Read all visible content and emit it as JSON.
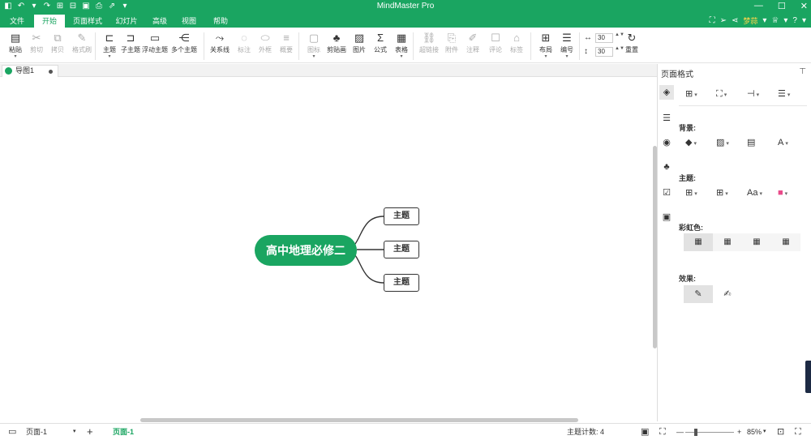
{
  "window": {
    "title": "MindMaster Pro",
    "quick_access": [
      "◧",
      "↶",
      "▾",
      "↷",
      "⊞",
      "⊟",
      "▣",
      "⎙",
      "⇗",
      "▾"
    ],
    "controls": [
      "—",
      "☐",
      "✕"
    ]
  },
  "menu": {
    "tabs": [
      "文件",
      "开始",
      "页面样式",
      "幻灯片",
      "高级",
      "视图",
      "帮助"
    ],
    "active": "开始",
    "right_icons": [
      "⛶",
      "➢",
      "⋖"
    ],
    "user": "梦蒜",
    "user_caret": "▾",
    "right_icons2": [
      "♕",
      "▾",
      "?",
      "▾"
    ]
  },
  "ribbon": {
    "buttons": [
      {
        "name": "paste",
        "label": "粘贴",
        "icon": "▤",
        "caret": "▾",
        "disabled": false
      },
      {
        "name": "cut",
        "label": "剪切",
        "icon": "✂",
        "disabled": true
      },
      {
        "name": "copy",
        "label": "拷贝",
        "icon": "⧉",
        "disabled": true
      },
      {
        "name": "format-painter",
        "label": "格式刷",
        "icon": "✎",
        "disabled": true
      },
      {
        "name": "topic",
        "label": "主题",
        "icon": "⊏",
        "caret": "▾",
        "disabled": false
      },
      {
        "name": "subtopic",
        "label": "子主题",
        "icon": "⊐",
        "disabled": false
      },
      {
        "name": "floating-topic",
        "label": "浮动主题",
        "icon": "▭",
        "disabled": false
      },
      {
        "name": "multiple-topics",
        "label": "多个主题",
        "icon": "⋲",
        "disabled": false
      },
      {
        "name": "relationship",
        "label": "关系线",
        "icon": "⤳",
        "disabled": false
      },
      {
        "name": "callout",
        "label": "标注",
        "icon": "◌",
        "disabled": true
      },
      {
        "name": "boundary",
        "label": "外框",
        "icon": "⬭",
        "disabled": true
      },
      {
        "name": "summary",
        "label": "概要",
        "icon": "≡",
        "disabled": true
      },
      {
        "name": "icon",
        "label": "图标",
        "icon": "▢",
        "caret": "▾",
        "disabled": true
      },
      {
        "name": "clipart",
        "label": "剪贴画",
        "icon": "♣",
        "disabled": false
      },
      {
        "name": "image",
        "label": "图片",
        "icon": "▨",
        "disabled": false
      },
      {
        "name": "formula",
        "label": "公式",
        "icon": "Σ",
        "disabled": false
      },
      {
        "name": "table",
        "label": "表格",
        "icon": "▦",
        "caret": "▾",
        "disabled": false
      },
      {
        "name": "hyperlink",
        "label": "超链接",
        "icon": "⛓",
        "disabled": true
      },
      {
        "name": "attachment",
        "label": "附件",
        "icon": "⎘",
        "disabled": true
      },
      {
        "name": "note",
        "label": "注释",
        "icon": "✐",
        "disabled": true
      },
      {
        "name": "comment",
        "label": "评论",
        "icon": "☐",
        "disabled": true
      },
      {
        "name": "tag",
        "label": "标签",
        "icon": "⌂",
        "disabled": true
      },
      {
        "name": "layout",
        "label": "布局",
        "icon": "⊞",
        "caret": "▾",
        "disabled": false
      },
      {
        "name": "numbering",
        "label": "编号",
        "icon": "☰",
        "caret": "▾",
        "disabled": false
      },
      {
        "name": "reset",
        "label": "重置",
        "icon": "↻",
        "disabled": false
      }
    ],
    "spin_width": {
      "icon": "↔",
      "value": "30",
      "arrows": "▲▼"
    },
    "spin_height": {
      "icon": "↕",
      "value": "30",
      "arrows": "▲▼"
    }
  },
  "doc_tab": {
    "label": "导图1"
  },
  "mindmap": {
    "central": "高中地理必修二",
    "topics": [
      "主题",
      "主题",
      "主题"
    ],
    "colors": {
      "accent": "#1aa561",
      "line": "#333333"
    }
  },
  "panel": {
    "title": "页面格式",
    "pin": "⊤",
    "vtabs": [
      "◈",
      "☰",
      "◉",
      "♣",
      "☑",
      "▣"
    ],
    "top_buttons": [
      "⊞",
      "⛶",
      "⊣",
      "☰"
    ],
    "sections": {
      "background": "背景:",
      "theme": "主题:",
      "rainbow": "彩虹色:",
      "effect": "效果:"
    },
    "bg_buttons": [
      "◆",
      "▨",
      "▤",
      "A"
    ],
    "theme_buttons": [
      "⊞",
      "⊞",
      "Aa",
      "■"
    ],
    "rainbow_options": [
      "▦",
      "▦",
      "▦",
      "▦"
    ],
    "effect_options": [
      "✎",
      "✍"
    ],
    "caret": "▾"
  },
  "status": {
    "page_icon": "▭",
    "page_select": "页面-1",
    "select_caret": "▾",
    "add_page": "+",
    "active_page": "页面-1",
    "topic_count_label": "主题计数:",
    "topic_count": "4",
    "fit_icons": [
      "▣",
      "⛶"
    ],
    "zoom_out": "—",
    "zoom_in": "+",
    "zoom": "85%",
    "zoom_caret": "▾",
    "end_icons": [
      "⊡",
      "⛶"
    ]
  }
}
